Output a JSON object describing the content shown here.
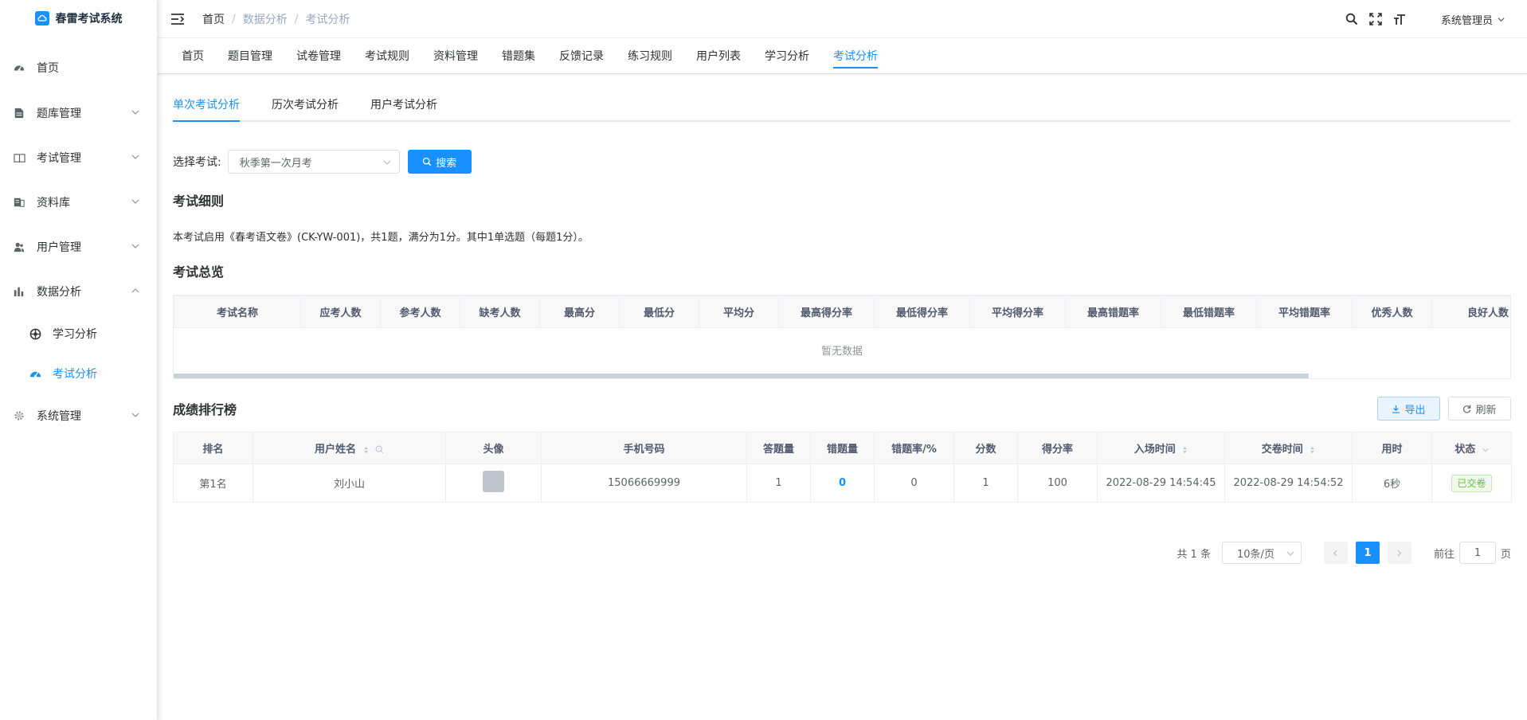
{
  "brand": {
    "title": "春雷考试系统"
  },
  "sidebar": {
    "items": [
      {
        "label": "首页"
      },
      {
        "label": "题库管理"
      },
      {
        "label": "考试管理"
      },
      {
        "label": "资料库"
      },
      {
        "label": "用户管理"
      },
      {
        "label": "数据分析"
      },
      {
        "label": "系统管理"
      }
    ],
    "sub_items": [
      {
        "label": "学习分析"
      },
      {
        "label": "考试分析"
      }
    ]
  },
  "header": {
    "breadcrumb": [
      "首页",
      "数据分析",
      "考试分析"
    ],
    "user": "系统管理员"
  },
  "tags": [
    "首页",
    "题目管理",
    "试卷管理",
    "考试规则",
    "资料管理",
    "错题集",
    "反馈记录",
    "练习规则",
    "用户列表",
    "学习分析",
    "考试分析"
  ],
  "subtabs": [
    "单次考试分析",
    "历次考试分析",
    "用户考试分析"
  ],
  "search": {
    "label": "选择考试:",
    "selected": "秋季第一次月考",
    "button": "搜索"
  },
  "rules": {
    "title": "考试细则",
    "text": "本考试启用《春考语文卷》(CK-YW-001)，共1题，满分为1分。其中1单选题（每题1分）。"
  },
  "overview": {
    "title": "考试总览",
    "columns": [
      "考试名称",
      "应考人数",
      "参考人数",
      "缺考人数",
      "最高分",
      "最低分",
      "平均分",
      "最高得分率",
      "最低得分率",
      "平均得分率",
      "最高错题率",
      "最低错题率",
      "平均错题率",
      "优秀人数",
      "良好人数"
    ],
    "empty": "暂无数据"
  },
  "ranking": {
    "title": "成绩排行榜",
    "export_label": "导出",
    "refresh_label": "刷新",
    "columns": [
      "排名",
      "用户姓名",
      "头像",
      "手机号码",
      "答题量",
      "错题量",
      "错题率/%",
      "分数",
      "得分率",
      "入场时间",
      "交卷时间",
      "用时",
      "状态"
    ],
    "rows": [
      {
        "rank": "第1名",
        "name": "刘小山",
        "phone": "15066669999",
        "answered": "1",
        "wrong": "0",
        "wrong_rate": "0",
        "score": "1",
        "score_rate": "100",
        "enter_time": "2022-08-29 14:54:45",
        "submit_time": "2022-08-29 14:54:52",
        "duration": "6秒",
        "status": "已交卷"
      }
    ]
  },
  "pagination": {
    "total": "共 1 条",
    "page_size": "10条/页",
    "current": "1",
    "goto_prefix": "前往",
    "goto_value": "1",
    "goto_suffix": "页"
  },
  "colors": {
    "primary": "#1890ff",
    "success": "#67c23a"
  }
}
